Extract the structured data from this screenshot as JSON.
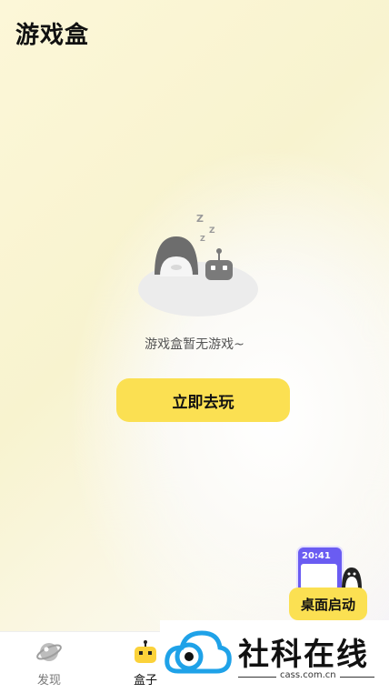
{
  "header": {
    "title": "游戏盒"
  },
  "empty_state": {
    "message": "游戏盒暂无游戏~",
    "zzz": "Z Z Z"
  },
  "primary_action": {
    "label": "立即去玩"
  },
  "desktop_launch": {
    "label": "桌面启动",
    "phone_time": "20:41"
  },
  "tabbar": {
    "items": [
      {
        "label": "发现",
        "icon": "planet-icon",
        "active": false
      },
      {
        "label": "盒子",
        "icon": "robot-box-icon",
        "active": true
      }
    ]
  },
  "watermark": {
    "name": "社科在线",
    "domain": "cass.com.cn"
  },
  "colors": {
    "accent": "#fbe052",
    "phone": "#6a5cf2",
    "logo": "#1fa2e8"
  }
}
